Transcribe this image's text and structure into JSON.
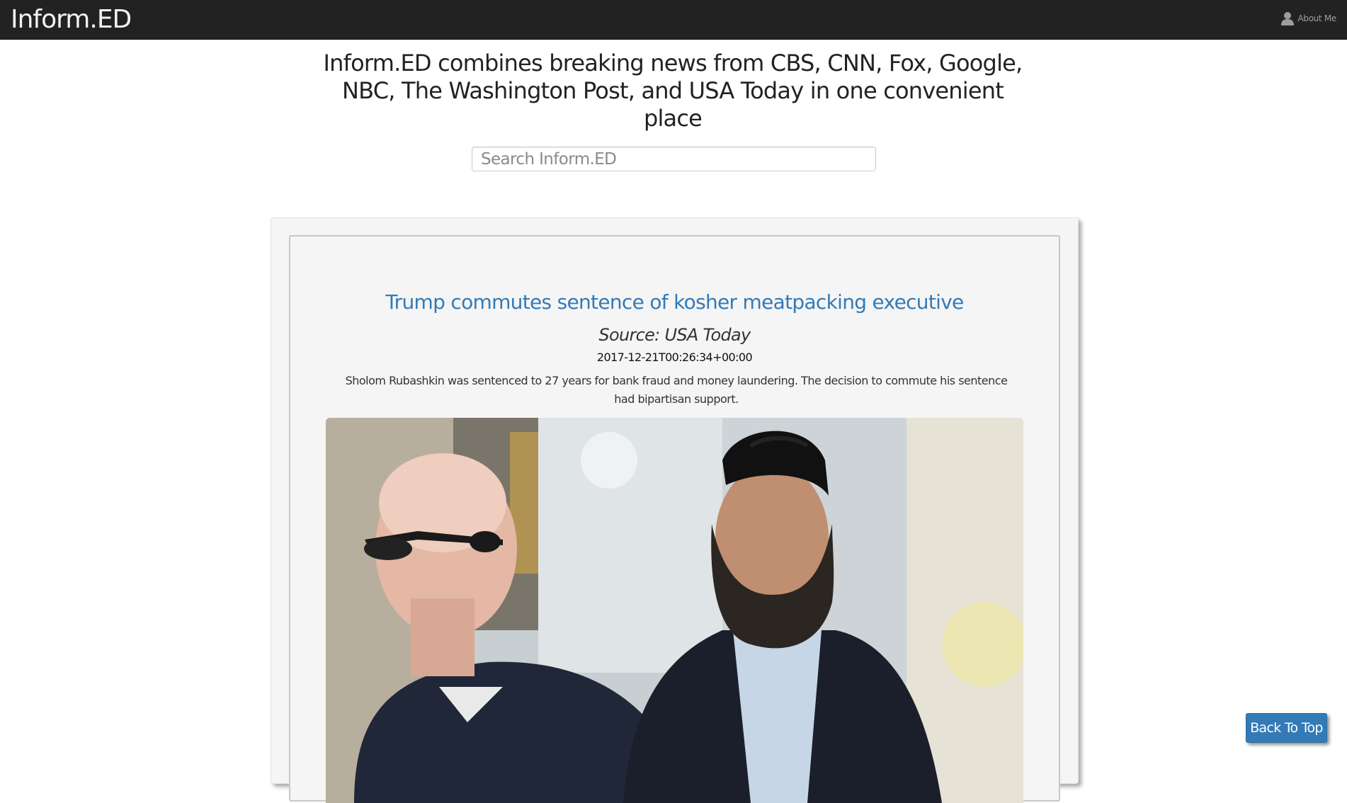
{
  "navbar": {
    "brand": "Inform.ED",
    "about_label": "About Me",
    "about_icon": "user-icon"
  },
  "hero": {
    "tagline": "Inform.ED combines breaking news from CBS, CNN, Fox, Google, NBC, The Washington Post, and USA Today in one convenient place"
  },
  "search": {
    "placeholder": "Search Inform.ED",
    "value": ""
  },
  "articles": [
    {
      "title": "Trump commutes sentence of kosher meatpacking executive",
      "source": "Source: USA Today",
      "published": "2017-12-21T00:26:34+00:00",
      "description": "Sholom Rubashkin was sentenced to 27 years for bank fraud and money laundering. The decision to commute his sentence had bipartisan support."
    }
  ],
  "back_to_top": {
    "label": "Back To Top"
  },
  "colors": {
    "navbar_bg": "#222222",
    "link": "#337ab7",
    "button": "#337ab7",
    "panel_bg": "#f5f5f5"
  }
}
